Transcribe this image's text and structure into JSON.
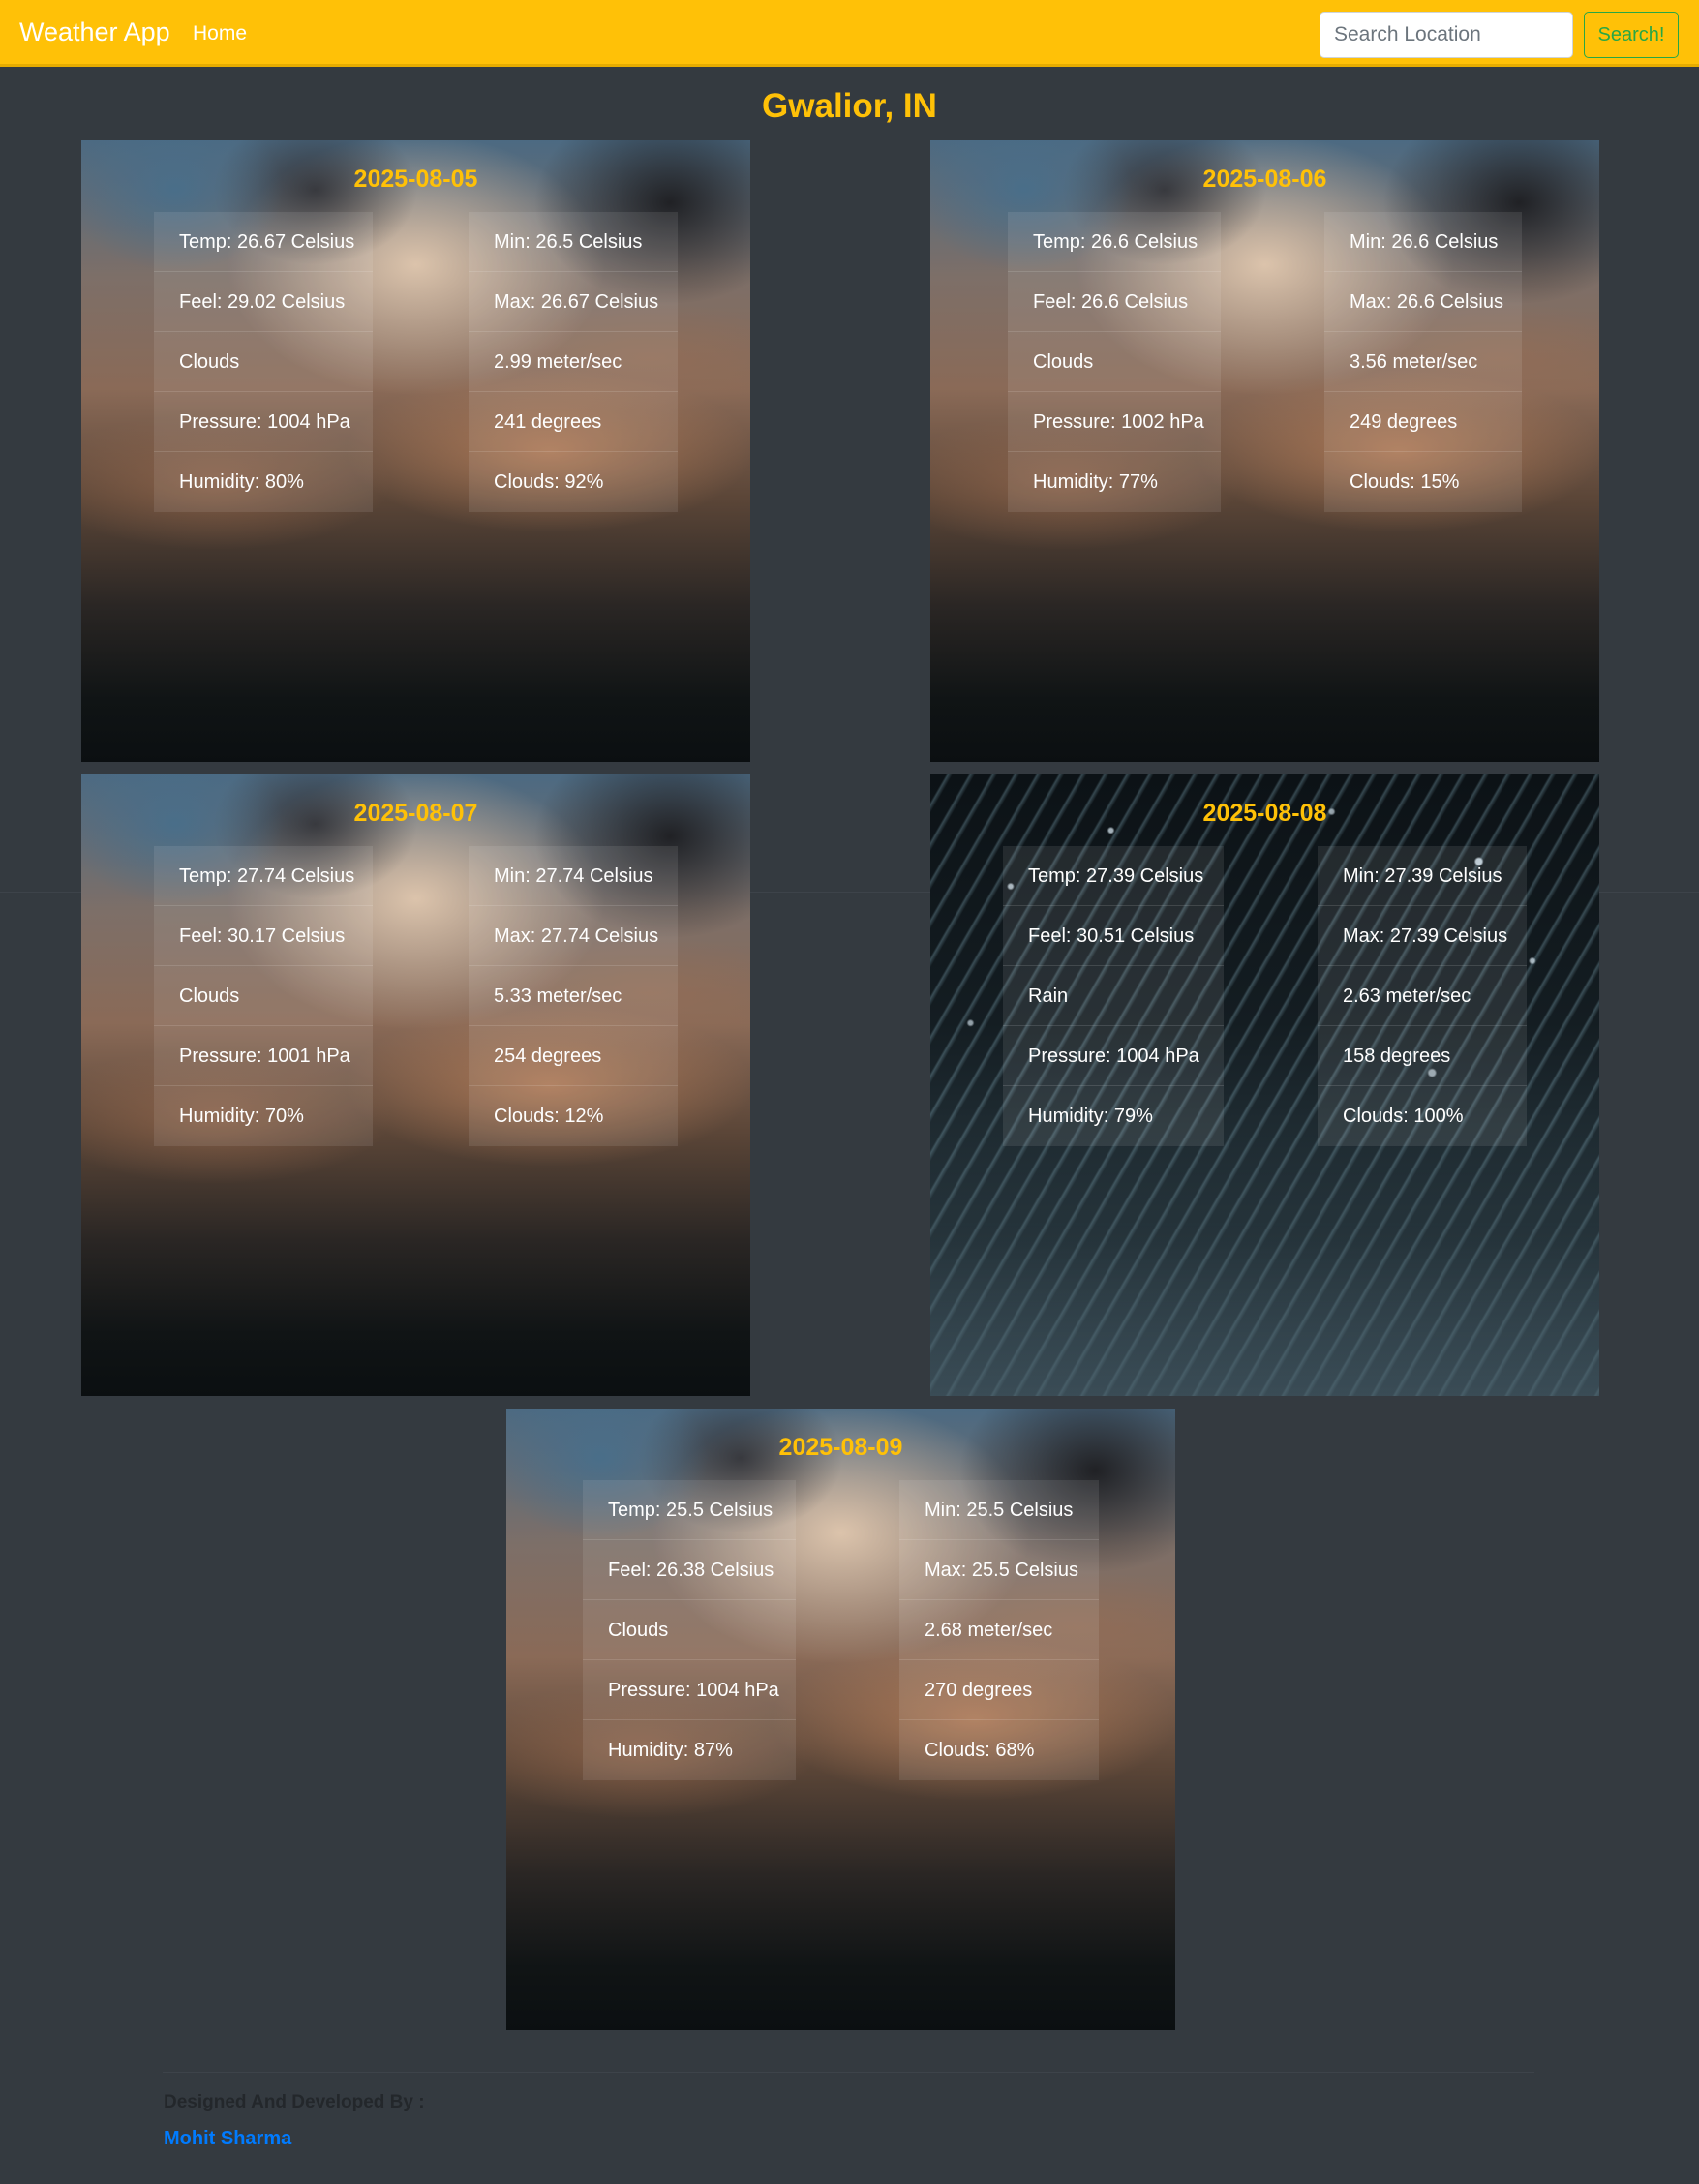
{
  "navbar": {
    "brand": "Weather App",
    "home_label": "Home",
    "search_placeholder": "Search Location",
    "search_button": "Search!"
  },
  "city": "Gwalior, IN",
  "colors": {
    "navbar": "#ffc107",
    "accent": "#ffc107",
    "background": "#343a40",
    "search_button": "#28a745",
    "link": "#007bff"
  },
  "forecast": [
    {
      "date": "2025-08-05",
      "background": "cloudy-sky",
      "left": [
        "Temp: 26.67 Celsius",
        "Feel: 29.02 Celsius",
        "Clouds",
        "Pressure: 1004 hPa",
        "Humidity: 80%"
      ],
      "right": [
        "Min: 26.5 Celsius",
        "Max: 26.67 Celsius",
        "2.99 meter/sec",
        "241 degrees",
        "Clouds: 92%"
      ]
    },
    {
      "date": "2025-08-06",
      "background": "cloudy-sky",
      "left": [
        "Temp: 26.6 Celsius",
        "Feel: 26.6 Celsius",
        "Clouds",
        "Pressure: 1002 hPa",
        "Humidity: 77%"
      ],
      "right": [
        "Min: 26.6 Celsius",
        "Max: 26.6 Celsius",
        "3.56 meter/sec",
        "249 degrees",
        "Clouds: 15%"
      ]
    },
    {
      "date": "2025-08-07",
      "background": "cloudy-sky",
      "left": [
        "Temp: 27.74 Celsius",
        "Feel: 30.17 Celsius",
        "Clouds",
        "Pressure: 1001 hPa",
        "Humidity: 70%"
      ],
      "right": [
        "Min: 27.74 Celsius",
        "Max: 27.74 Celsius",
        "5.33 meter/sec",
        "254 degrees",
        "Clouds: 12%"
      ]
    },
    {
      "date": "2025-08-08",
      "background": "rain",
      "left": [
        "Temp: 27.39 Celsius",
        "Feel: 30.51 Celsius",
        "Rain",
        "Pressure: 1004 hPa",
        "Humidity: 79%"
      ],
      "right": [
        "Min: 27.39 Celsius",
        "Max: 27.39 Celsius",
        "2.63 meter/sec",
        "158 degrees",
        "Clouds: 100%"
      ]
    },
    {
      "date": "2025-08-09",
      "background": "cloudy-sky",
      "left": [
        "Temp: 25.5 Celsius",
        "Feel: 26.38 Celsius",
        "Clouds",
        "Pressure: 1004 hPa",
        "Humidity: 87%"
      ],
      "right": [
        "Min: 25.5 Celsius",
        "Max: 25.5 Celsius",
        "2.68 meter/sec",
        "270 degrees",
        "Clouds: 68%"
      ]
    }
  ],
  "footer": {
    "credit_label": "Designed And Developed By :",
    "author": "Mohit Sharma"
  }
}
